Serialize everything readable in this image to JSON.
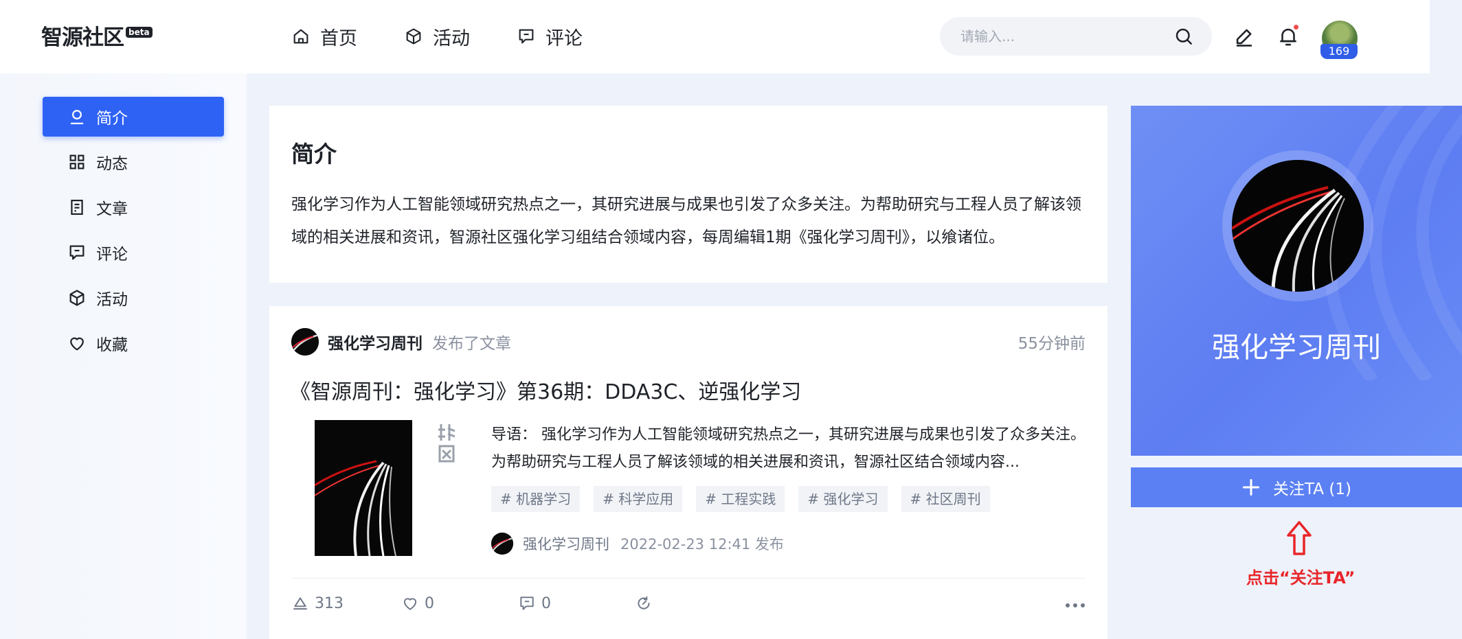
{
  "header": {
    "logo": "智源社区",
    "logo_badge": "beta",
    "nav": [
      {
        "label": "首页",
        "icon": "home-icon"
      },
      {
        "label": "活动",
        "icon": "cube-icon"
      },
      {
        "label": "评论",
        "icon": "comment-icon"
      }
    ],
    "search_placeholder": "请输入...",
    "avatar_badge": "169"
  },
  "sidebar": {
    "items": [
      {
        "label": "简介",
        "icon": "user-icon",
        "active": true
      },
      {
        "label": "动态",
        "icon": "grid-icon"
      },
      {
        "label": "文章",
        "icon": "document-icon"
      },
      {
        "label": "评论",
        "icon": "comment-icon"
      },
      {
        "label": "活动",
        "icon": "cube-icon"
      },
      {
        "label": "收藏",
        "icon": "heart-icon"
      }
    ]
  },
  "intro": {
    "title": "简介",
    "text": "强化学习作为人工智能领域研究热点之一，其研究进展与成果也引发了众多关注。为帮助研究与工程人员了解该领域的相关进展和资讯，智源社区强化学习组结合领域内容，每周编辑1期《强化学习周刊》，以飨诸位。"
  },
  "post": {
    "author": "强化学习周刊",
    "action": "发布了文章",
    "time": "55分钟前",
    "title": "《智源周刊：强化学习》第36期：DDA3C、逆强化学习",
    "summary": "导语： 强化学习作为人工智能领域研究热点之一，其研究进展与成果也引发了众多关注。为帮助研究与工程人员了解该领域的相关进展和资讯，智源社区结合领域内容...",
    "tags": [
      "# 机器学习",
      "# 科学应用",
      "# 工程实践",
      "# 强化学习",
      "# 社区周刊"
    ],
    "footer_author": "强化学习周刊",
    "date": "2022-02-23 12:41 发布",
    "stats": {
      "views": "313",
      "likes": "0",
      "comments": "0"
    }
  },
  "profile": {
    "name": "强化学习周刊",
    "follow_label": "关注TA (1)"
  },
  "annotation": {
    "text": "点击“关注TA”",
    "color": "#e8262a"
  },
  "colors": {
    "accent": "#2e62f5",
    "profile_bg": "#6384f4",
    "follow_btn": "#5b80f4"
  }
}
